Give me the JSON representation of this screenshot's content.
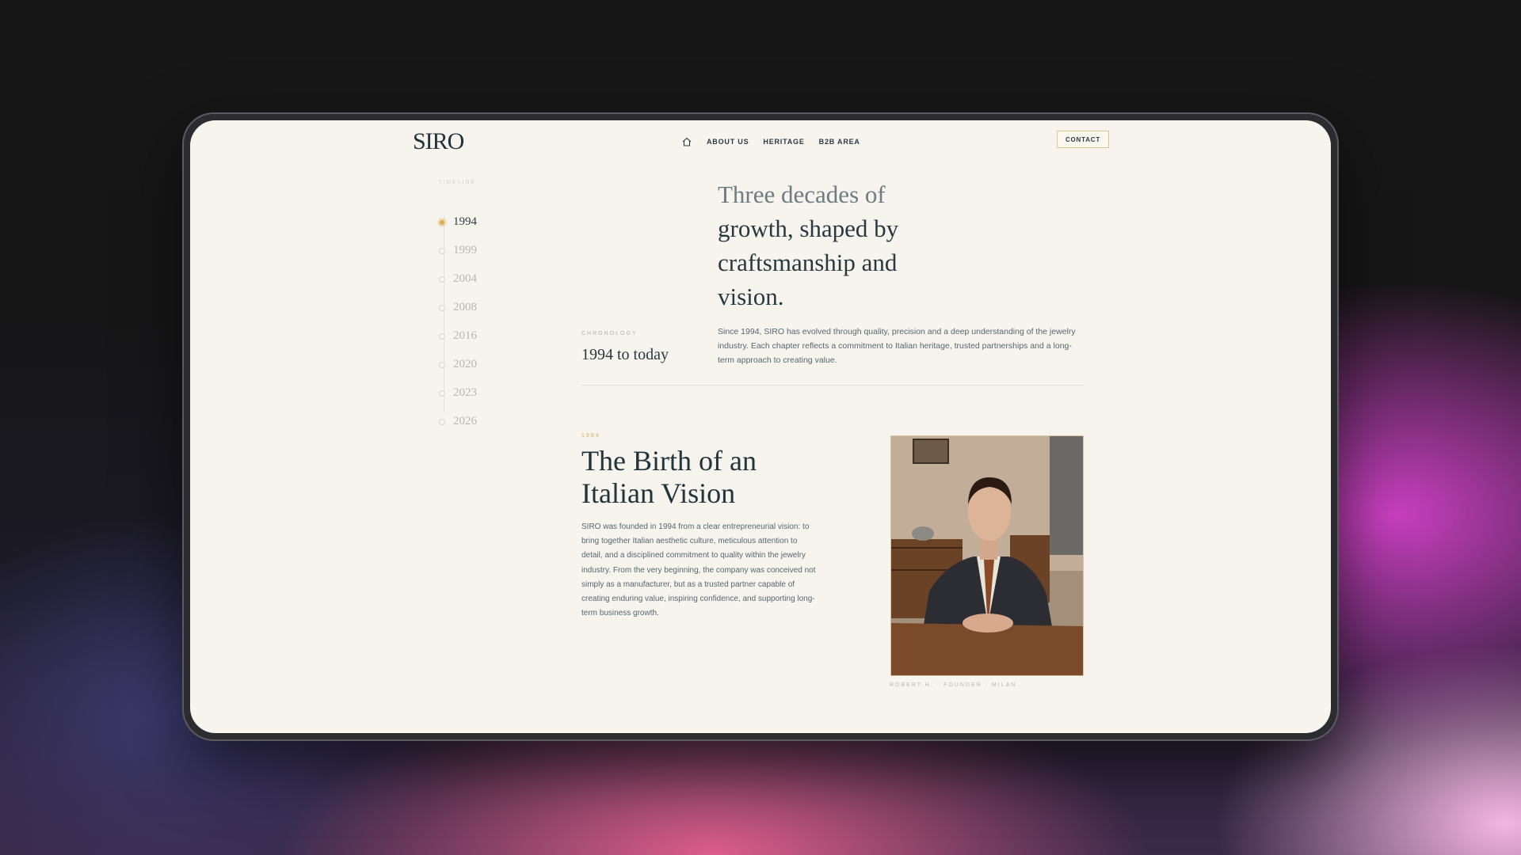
{
  "brand": {
    "logo": "SIRO"
  },
  "nav": {
    "home_icon": "home-icon",
    "links": [
      "ABOUT US",
      "HERITAGE",
      "B2B AREA"
    ],
    "contact_label": "CONTACT"
  },
  "timeline": {
    "heading": "TIMELINE",
    "years": [
      "1994",
      "1999",
      "2004",
      "2008",
      "2016",
      "2020",
      "2023",
      "2026"
    ],
    "active_year": "1994"
  },
  "hero": {
    "title_part1": "Three decades of",
    "title_part2": "growth, shaped by craftsmanship and vision.",
    "chronology_label": "CHRONOLOGY",
    "range": "1994 to today",
    "intro": "Since 1994, SIRO has evolved through quality, precision and a deep understanding of the jewelry industry. Each chapter reflects a commitment to Italian heritage, trusted partnerships and a long-term approach to creating value."
  },
  "section": {
    "year": "1994",
    "title": "The Birth of an Italian Vision",
    "body": "SIRO was founded in 1994 from a clear entrepreneurial vision: to bring together Italian aesthetic culture, meticulous attention to detail, and a disciplined commitment to quality within the jewelry industry. From the very beginning, the company was conceived not simply as a manufacturer, but as a trusted partner capable of creating enduring value, inspiring confidence, and supporting long-term business growth.",
    "photo_caption": "ROBERT H. · FOUNDER · MILAN"
  },
  "colors": {
    "accent": "#d9ae5a",
    "text_dark": "#27393f",
    "page_bg": "#f7f4ee"
  }
}
